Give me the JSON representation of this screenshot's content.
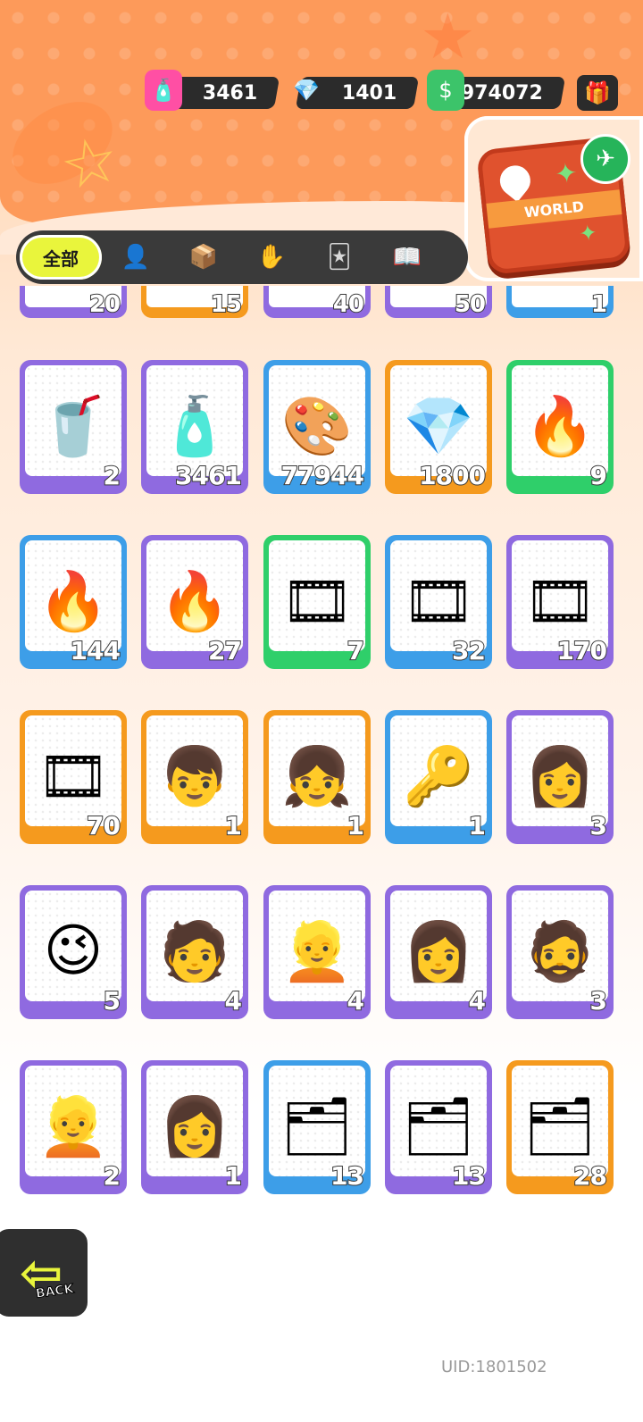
{
  "currencies": [
    {
      "name": "spray-can",
      "value": "3461",
      "icon": "spray-can-icon"
    },
    {
      "name": "gem",
      "value": "1401",
      "icon": "diamond-icon"
    },
    {
      "name": "cash",
      "value": "974072",
      "icon": "cash-icon"
    }
  ],
  "tabs": {
    "all_label": "全部",
    "icons": [
      "person-icon",
      "box-icon",
      "hand-icon",
      "cards-icon",
      "book-icon"
    ]
  },
  "world_badge": {
    "label": "WORLD"
  },
  "partial_row": [
    "20",
    "15",
    "40",
    "50",
    "1"
  ],
  "items": [
    {
      "count": "2",
      "color": "purple",
      "icon": "jelly-cup-icon",
      "glyph": "🥤"
    },
    {
      "count": "3461",
      "color": "purple",
      "icon": "spray-can-icon",
      "glyph": "🧴"
    },
    {
      "count": "77944",
      "color": "blue",
      "icon": "paint-tube-icon",
      "glyph": "🎨"
    },
    {
      "count": "1800",
      "color": "orange",
      "icon": "gold-crystal-icon",
      "glyph": "💎"
    },
    {
      "count": "9",
      "color": "green",
      "icon": "green-flame-icon",
      "glyph": "🔥"
    },
    {
      "count": "144",
      "color": "blue",
      "icon": "blue-flame-icon",
      "glyph": "🔥"
    },
    {
      "count": "27",
      "color": "purple",
      "icon": "purple-flame-icon",
      "glyph": "🔥"
    },
    {
      "count": "7",
      "color": "green",
      "icon": "green-tape-icon",
      "glyph": "🎞"
    },
    {
      "count": "32",
      "color": "blue",
      "icon": "blue-tape-card-icon",
      "glyph": "🎞"
    },
    {
      "count": "170",
      "color": "purple",
      "icon": "purple-tape-card-icon",
      "glyph": "🎞"
    },
    {
      "count": "70",
      "color": "orange",
      "icon": "gold-tape-card-icon",
      "glyph": "🎞"
    },
    {
      "count": "1",
      "color": "orange",
      "icon": "deity-character-icon",
      "glyph": "👦"
    },
    {
      "count": "1",
      "color": "orange",
      "icon": "deity-character-icon",
      "glyph": "👧"
    },
    {
      "count": "1",
      "color": "blue",
      "icon": "usb-key-icon",
      "glyph": "🔑"
    },
    {
      "count": "3",
      "color": "purple",
      "icon": "deity-character-icon",
      "glyph": "👩"
    },
    {
      "count": "5",
      "color": "purple",
      "icon": "deity-character-icon",
      "glyph": "😉"
    },
    {
      "count": "4",
      "color": "purple",
      "icon": "deity-character-icon",
      "glyph": "🧑"
    },
    {
      "count": "4",
      "color": "purple",
      "icon": "deity-character-icon",
      "glyph": "👱"
    },
    {
      "count": "4",
      "color": "purple",
      "icon": "deity-character-icon",
      "glyph": "👩"
    },
    {
      "count": "3",
      "color": "purple",
      "icon": "deity-character-icon",
      "glyph": "🧔"
    },
    {
      "count": "2",
      "color": "purple",
      "icon": "deity-character-icon",
      "glyph": "👱"
    },
    {
      "count": "1",
      "color": "purple",
      "icon": "deity-character-icon",
      "glyph": "👩"
    },
    {
      "count": "13",
      "color": "blue",
      "icon": "sticker-pack-icon",
      "glyph": "🗂"
    },
    {
      "count": "13",
      "color": "purple",
      "icon": "sticker-pack-icon",
      "glyph": "🗂"
    },
    {
      "count": "28",
      "color": "orange",
      "icon": "sticker-pack-icon",
      "glyph": "🗂"
    }
  ],
  "back": {
    "label": "BACK"
  },
  "uid": "UID:1801502",
  "colors": {
    "purple": "#8f6ae0",
    "blue": "#3d9ee8",
    "orange": "#f59a1e",
    "green": "#2fcf6a",
    "accent": "#e9f53c"
  }
}
